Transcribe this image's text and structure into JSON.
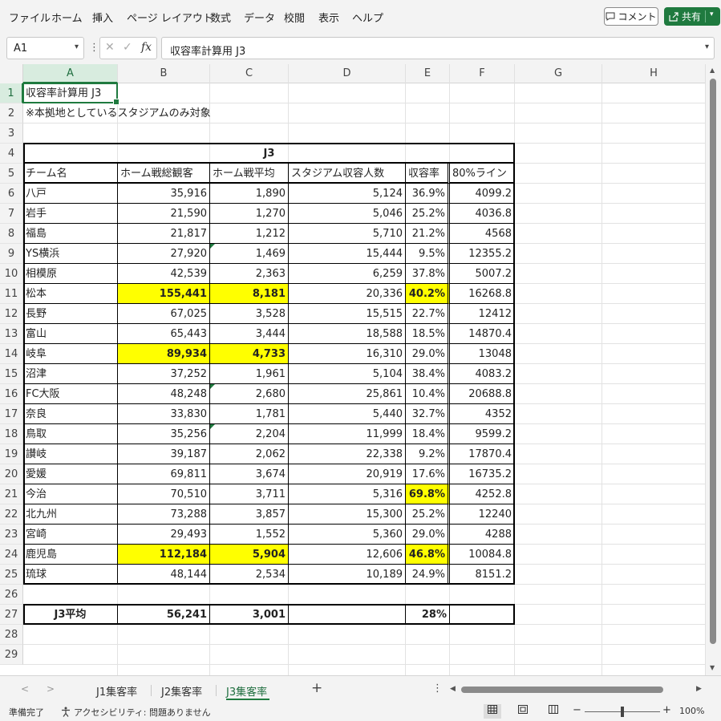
{
  "menu": [
    "ファイル",
    "ホーム",
    "挿入",
    "ページ レイアウト",
    "数式",
    "データ",
    "校閲",
    "表示",
    "ヘルプ"
  ],
  "buttons": {
    "comment": "コメント",
    "share": "共有"
  },
  "icons": {
    "comment": "speech-bubble-icon",
    "share": "share-icon",
    "fx": "fx-icon"
  },
  "formula_bar": {
    "name_box": "A1",
    "fx": "fx",
    "cancel": "✕",
    "enter": "✓",
    "content": "収容率計算用 J3"
  },
  "columns": [
    "A",
    "B",
    "C",
    "D",
    "E",
    "F",
    "G",
    "H"
  ],
  "rows": [
    "1",
    "2",
    "3",
    "4",
    "5",
    "6",
    "7",
    "8",
    "9",
    "10",
    "11",
    "12",
    "13",
    "14",
    "15",
    "16",
    "17",
    "18",
    "19",
    "20",
    "21",
    "22",
    "23",
    "24",
    "25",
    "26",
    "27",
    "28",
    "29"
  ],
  "sheet": {
    "title": "収容率計算用 J3",
    "note": "※本拠地としているスタジアムのみ対象",
    "table_title": "J3",
    "headers": [
      "チーム名",
      "ホーム戦総観客",
      "ホーム戦平均",
      "スタジアム収容人数",
      "収容率",
      "80%ライン"
    ],
    "data": [
      [
        "八戸",
        "35,916",
        "1,890",
        "5,124",
        "36.9%",
        "4099.2"
      ],
      [
        "岩手",
        "21,590",
        "1,270",
        "5,046",
        "25.2%",
        "4036.8"
      ],
      [
        "福島",
        "21,817",
        "1,212",
        "5,710",
        "21.2%",
        "4568"
      ],
      [
        "YS横浜",
        "27,920",
        "1,469",
        "15,444",
        "9.5%",
        "12355.2"
      ],
      [
        "相模原",
        "42,539",
        "2,363",
        "6,259",
        "37.8%",
        "5007.2"
      ],
      [
        "松本",
        "155,441",
        "8,181",
        "20,336",
        "40.2%",
        "16268.8"
      ],
      [
        "長野",
        "67,025",
        "3,528",
        "15,515",
        "22.7%",
        "12412"
      ],
      [
        "富山",
        "65,443",
        "3,444",
        "18,588",
        "18.5%",
        "14870.4"
      ],
      [
        "岐阜",
        "89,934",
        "4,733",
        "16,310",
        "29.0%",
        "13048"
      ],
      [
        "沼津",
        "37,252",
        "1,961",
        "5,104",
        "38.4%",
        "4083.2"
      ],
      [
        "FC大阪",
        "48,248",
        "2,680",
        "25,861",
        "10.4%",
        "20688.8"
      ],
      [
        "奈良",
        "33,830",
        "1,781",
        "5,440",
        "32.7%",
        "4352"
      ],
      [
        "鳥取",
        "35,256",
        "2,204",
        "11,999",
        "18.4%",
        "9599.2"
      ],
      [
        "讃岐",
        "39,187",
        "2,062",
        "22,338",
        "9.2%",
        "17870.4"
      ],
      [
        "愛媛",
        "69,811",
        "3,674",
        "20,919",
        "17.6%",
        "16735.2"
      ],
      [
        "今治",
        "70,510",
        "3,711",
        "5,316",
        "69.8%",
        "4252.8"
      ],
      [
        "北九州",
        "73,288",
        "3,857",
        "15,300",
        "25.2%",
        "12240"
      ],
      [
        "宮崎",
        "29,493",
        "1,552",
        "5,360",
        "29.0%",
        "4288"
      ],
      [
        "鹿児島",
        "112,184",
        "5,904",
        "12,606",
        "46.8%",
        "10084.8"
      ],
      [
        "琉球",
        "48,144",
        "2,534",
        "10,189",
        "24.9%",
        "8151.2"
      ]
    ],
    "highlight": [
      {
        "row": 5,
        "cols": [
          1,
          2,
          4
        ]
      },
      {
        "row": 8,
        "cols": [
          1,
          2
        ]
      },
      {
        "row": 15,
        "cols": [
          4
        ]
      },
      {
        "row": 18,
        "cols": [
          1,
          2,
          4
        ]
      }
    ],
    "error_indicators": [
      {
        "row": 3,
        "col": 2
      },
      {
        "row": 10,
        "col": 2
      },
      {
        "row": 12,
        "col": 2
      }
    ],
    "average": {
      "label": "J3平均",
      "total": "56,241",
      "avg": "3,001",
      "capacity": "",
      "rate": "28%",
      "line": ""
    }
  },
  "tabs": [
    "J1集客率",
    "J2集客率",
    "J3集客率"
  ],
  "active_tab": "J3集客率",
  "add_sheet": "+",
  "more": "⋮",
  "status": {
    "ready": "準備完了",
    "accessibility": "アクセシビリティ: 問題ありません",
    "zoom": "100%",
    "zoom_minus": "−",
    "zoom_plus": "+"
  },
  "colors": {
    "accent": "#1f7a3f",
    "highlight": "#ffff00"
  }
}
